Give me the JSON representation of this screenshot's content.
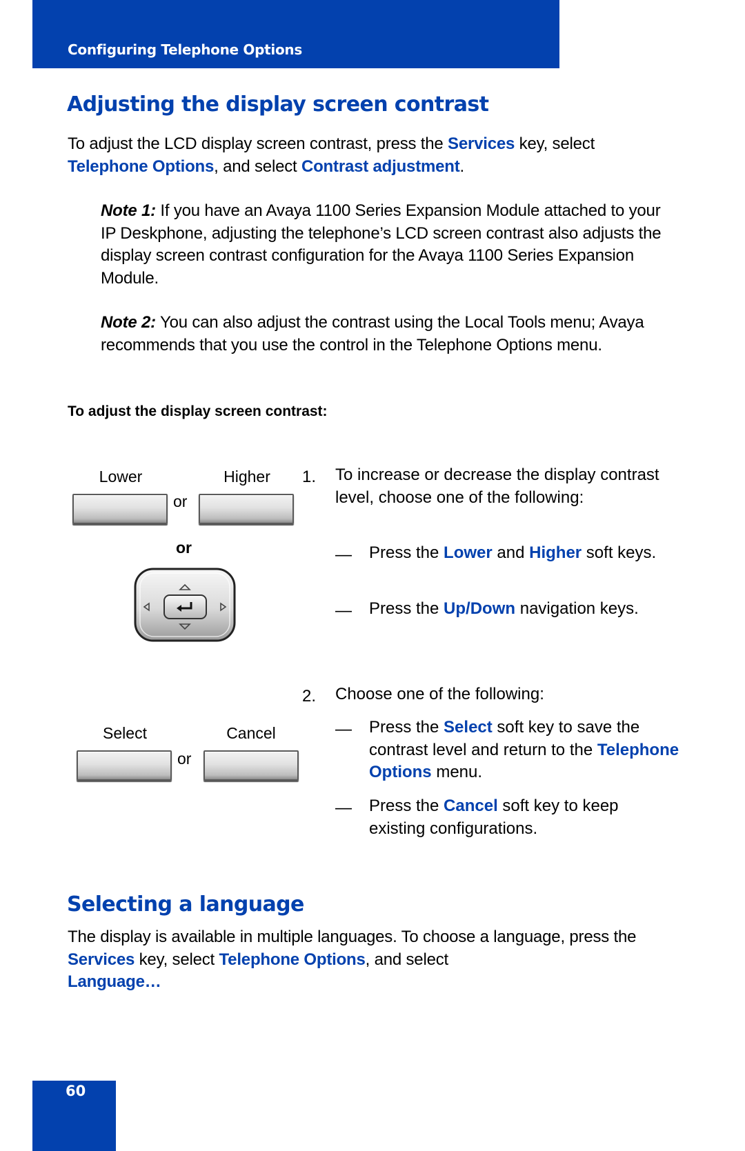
{
  "header": {
    "section_title": "Configuring Telephone Options",
    "accent_color": "#0341ae"
  },
  "contrast_section": {
    "title": "Adjusting the display screen contrast",
    "intro": {
      "t1": "To adjust the LCD display screen contrast, press the ",
      "k1": "Services",
      "t2": " key, select ",
      "k2": "Telephone Options",
      "t3": ", and select ",
      "k3": "Contrast adjustment",
      "t4": "."
    },
    "note1": {
      "label": "Note 1:",
      "text": " If you have an Avaya 1100 Series Expansion Module attached to your IP Deskphone, adjusting the telephone’s LCD screen contrast also adjusts the display screen contrast configuration for the Avaya 1100 Series Expansion Module."
    },
    "note2": {
      "label": "Note 2:",
      "text": " You can also adjust the contrast using the Local Tools menu; Avaya recommends that you use the control in the Telephone Options menu."
    },
    "procedure_heading": "To adjust the display screen contrast:",
    "softkeys_step1": {
      "left_label": "Lower",
      "right_label": "Higher",
      "or_small": "or",
      "or_bold": "or",
      "nav_cluster_name": "navigation-keys"
    },
    "softkeys_step2": {
      "left_label": "Select",
      "right_label": "Cancel",
      "or_small": "or"
    },
    "steps": [
      {
        "number": "1.",
        "text": "To increase or decrease the display contrast level, choose one of the following:",
        "options": [
          {
            "dash": "—",
            "t1": "Press the ",
            "k1": "Lower",
            "t2": " and ",
            "k2": "Higher",
            "t3": " soft keys."
          },
          {
            "dash": "—",
            "t1": "Press the ",
            "k1": "Up",
            "sep": "/",
            "k2": "Down",
            "t2": " navigation keys."
          }
        ]
      },
      {
        "number": "2.",
        "text": "Choose one of the following:",
        "options": [
          {
            "dash": "—",
            "t1": "Press the ",
            "k1": "Select",
            "t2": " soft key to save the contrast level and return to the ",
            "k2": "Telephone Options",
            "t3": " menu."
          },
          {
            "dash": "—",
            "t1": "Press the ",
            "k1": "Cancel",
            "t2": " soft key to keep existing configurations."
          }
        ]
      }
    ]
  },
  "language_section": {
    "title": "Selecting a language",
    "body": {
      "t1": "The display is available in multiple languages. To choose a language, press the ",
      "k1": "Services",
      "t2": " key, select ",
      "k2": "Telephone Options",
      "t3": ", and select ",
      "k3": "Language…"
    }
  },
  "footer": {
    "page_number": "60"
  }
}
